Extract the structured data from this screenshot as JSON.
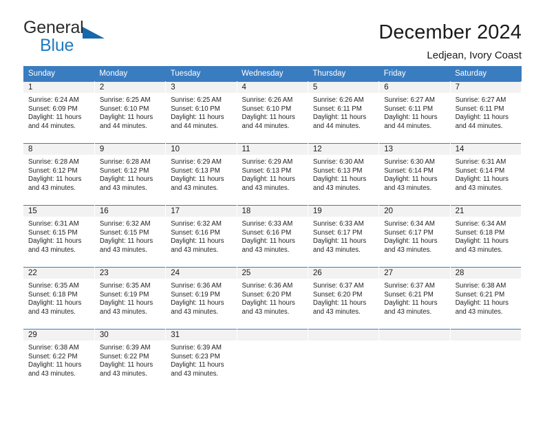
{
  "brand": {
    "name_primary": "General",
    "name_secondary": "Blue",
    "triangle_color": "#1668ad",
    "blue_color": "#1f7bc1"
  },
  "header": {
    "title": "December 2024",
    "subtitle": "Ledjean, Ivory Coast"
  },
  "theme": {
    "header_row_bg": "#3a7cc0",
    "header_row_text": "#ffffff",
    "daynum_band_bg": "#f2f2f2",
    "row_divider": "#3a7cc0",
    "body_text": "#222222"
  },
  "weekday_headers": [
    "Sunday",
    "Monday",
    "Tuesday",
    "Wednesday",
    "Thursday",
    "Friday",
    "Saturday"
  ],
  "weeks": [
    [
      {
        "day": "1",
        "sunrise": "Sunrise: 6:24 AM",
        "sunset": "Sunset: 6:09 PM",
        "daylight_line1": "Daylight: 11 hours",
        "daylight_line2": "and 44 minutes."
      },
      {
        "day": "2",
        "sunrise": "Sunrise: 6:25 AM",
        "sunset": "Sunset: 6:10 PM",
        "daylight_line1": "Daylight: 11 hours",
        "daylight_line2": "and 44 minutes."
      },
      {
        "day": "3",
        "sunrise": "Sunrise: 6:25 AM",
        "sunset": "Sunset: 6:10 PM",
        "daylight_line1": "Daylight: 11 hours",
        "daylight_line2": "and 44 minutes."
      },
      {
        "day": "4",
        "sunrise": "Sunrise: 6:26 AM",
        "sunset": "Sunset: 6:10 PM",
        "daylight_line1": "Daylight: 11 hours",
        "daylight_line2": "and 44 minutes."
      },
      {
        "day": "5",
        "sunrise": "Sunrise: 6:26 AM",
        "sunset": "Sunset: 6:11 PM",
        "daylight_line1": "Daylight: 11 hours",
        "daylight_line2": "and 44 minutes."
      },
      {
        "day": "6",
        "sunrise": "Sunrise: 6:27 AM",
        "sunset": "Sunset: 6:11 PM",
        "daylight_line1": "Daylight: 11 hours",
        "daylight_line2": "and 44 minutes."
      },
      {
        "day": "7",
        "sunrise": "Sunrise: 6:27 AM",
        "sunset": "Sunset: 6:11 PM",
        "daylight_line1": "Daylight: 11 hours",
        "daylight_line2": "and 44 minutes."
      }
    ],
    [
      {
        "day": "8",
        "sunrise": "Sunrise: 6:28 AM",
        "sunset": "Sunset: 6:12 PM",
        "daylight_line1": "Daylight: 11 hours",
        "daylight_line2": "and 43 minutes."
      },
      {
        "day": "9",
        "sunrise": "Sunrise: 6:28 AM",
        "sunset": "Sunset: 6:12 PM",
        "daylight_line1": "Daylight: 11 hours",
        "daylight_line2": "and 43 minutes."
      },
      {
        "day": "10",
        "sunrise": "Sunrise: 6:29 AM",
        "sunset": "Sunset: 6:13 PM",
        "daylight_line1": "Daylight: 11 hours",
        "daylight_line2": "and 43 minutes."
      },
      {
        "day": "11",
        "sunrise": "Sunrise: 6:29 AM",
        "sunset": "Sunset: 6:13 PM",
        "daylight_line1": "Daylight: 11 hours",
        "daylight_line2": "and 43 minutes."
      },
      {
        "day": "12",
        "sunrise": "Sunrise: 6:30 AM",
        "sunset": "Sunset: 6:13 PM",
        "daylight_line1": "Daylight: 11 hours",
        "daylight_line2": "and 43 minutes."
      },
      {
        "day": "13",
        "sunrise": "Sunrise: 6:30 AM",
        "sunset": "Sunset: 6:14 PM",
        "daylight_line1": "Daylight: 11 hours",
        "daylight_line2": "and 43 minutes."
      },
      {
        "day": "14",
        "sunrise": "Sunrise: 6:31 AM",
        "sunset": "Sunset: 6:14 PM",
        "daylight_line1": "Daylight: 11 hours",
        "daylight_line2": "and 43 minutes."
      }
    ],
    [
      {
        "day": "15",
        "sunrise": "Sunrise: 6:31 AM",
        "sunset": "Sunset: 6:15 PM",
        "daylight_line1": "Daylight: 11 hours",
        "daylight_line2": "and 43 minutes."
      },
      {
        "day": "16",
        "sunrise": "Sunrise: 6:32 AM",
        "sunset": "Sunset: 6:15 PM",
        "daylight_line1": "Daylight: 11 hours",
        "daylight_line2": "and 43 minutes."
      },
      {
        "day": "17",
        "sunrise": "Sunrise: 6:32 AM",
        "sunset": "Sunset: 6:16 PM",
        "daylight_line1": "Daylight: 11 hours",
        "daylight_line2": "and 43 minutes."
      },
      {
        "day": "18",
        "sunrise": "Sunrise: 6:33 AM",
        "sunset": "Sunset: 6:16 PM",
        "daylight_line1": "Daylight: 11 hours",
        "daylight_line2": "and 43 minutes."
      },
      {
        "day": "19",
        "sunrise": "Sunrise: 6:33 AM",
        "sunset": "Sunset: 6:17 PM",
        "daylight_line1": "Daylight: 11 hours",
        "daylight_line2": "and 43 minutes."
      },
      {
        "day": "20",
        "sunrise": "Sunrise: 6:34 AM",
        "sunset": "Sunset: 6:17 PM",
        "daylight_line1": "Daylight: 11 hours",
        "daylight_line2": "and 43 minutes."
      },
      {
        "day": "21",
        "sunrise": "Sunrise: 6:34 AM",
        "sunset": "Sunset: 6:18 PM",
        "daylight_line1": "Daylight: 11 hours",
        "daylight_line2": "and 43 minutes."
      }
    ],
    [
      {
        "day": "22",
        "sunrise": "Sunrise: 6:35 AM",
        "sunset": "Sunset: 6:18 PM",
        "daylight_line1": "Daylight: 11 hours",
        "daylight_line2": "and 43 minutes."
      },
      {
        "day": "23",
        "sunrise": "Sunrise: 6:35 AM",
        "sunset": "Sunset: 6:19 PM",
        "daylight_line1": "Daylight: 11 hours",
        "daylight_line2": "and 43 minutes."
      },
      {
        "day": "24",
        "sunrise": "Sunrise: 6:36 AM",
        "sunset": "Sunset: 6:19 PM",
        "daylight_line1": "Daylight: 11 hours",
        "daylight_line2": "and 43 minutes."
      },
      {
        "day": "25",
        "sunrise": "Sunrise: 6:36 AM",
        "sunset": "Sunset: 6:20 PM",
        "daylight_line1": "Daylight: 11 hours",
        "daylight_line2": "and 43 minutes."
      },
      {
        "day": "26",
        "sunrise": "Sunrise: 6:37 AM",
        "sunset": "Sunset: 6:20 PM",
        "daylight_line1": "Daylight: 11 hours",
        "daylight_line2": "and 43 minutes."
      },
      {
        "day": "27",
        "sunrise": "Sunrise: 6:37 AM",
        "sunset": "Sunset: 6:21 PM",
        "daylight_line1": "Daylight: 11 hours",
        "daylight_line2": "and 43 minutes."
      },
      {
        "day": "28",
        "sunrise": "Sunrise: 6:38 AM",
        "sunset": "Sunset: 6:21 PM",
        "daylight_line1": "Daylight: 11 hours",
        "daylight_line2": "and 43 minutes."
      }
    ],
    [
      {
        "day": "29",
        "sunrise": "Sunrise: 6:38 AM",
        "sunset": "Sunset: 6:22 PM",
        "daylight_line1": "Daylight: 11 hours",
        "daylight_line2": "and 43 minutes."
      },
      {
        "day": "30",
        "sunrise": "Sunrise: 6:39 AM",
        "sunset": "Sunset: 6:22 PM",
        "daylight_line1": "Daylight: 11 hours",
        "daylight_line2": "and 43 minutes."
      },
      {
        "day": "31",
        "sunrise": "Sunrise: 6:39 AM",
        "sunset": "Sunset: 6:23 PM",
        "daylight_line1": "Daylight: 11 hours",
        "daylight_line2": "and 43 minutes."
      },
      {
        "day": "",
        "sunrise": "",
        "sunset": "",
        "daylight_line1": "",
        "daylight_line2": ""
      },
      {
        "day": "",
        "sunrise": "",
        "sunset": "",
        "daylight_line1": "",
        "daylight_line2": ""
      },
      {
        "day": "",
        "sunrise": "",
        "sunset": "",
        "daylight_line1": "",
        "daylight_line2": ""
      },
      {
        "day": "",
        "sunrise": "",
        "sunset": "",
        "daylight_line1": "",
        "daylight_line2": ""
      }
    ]
  ]
}
